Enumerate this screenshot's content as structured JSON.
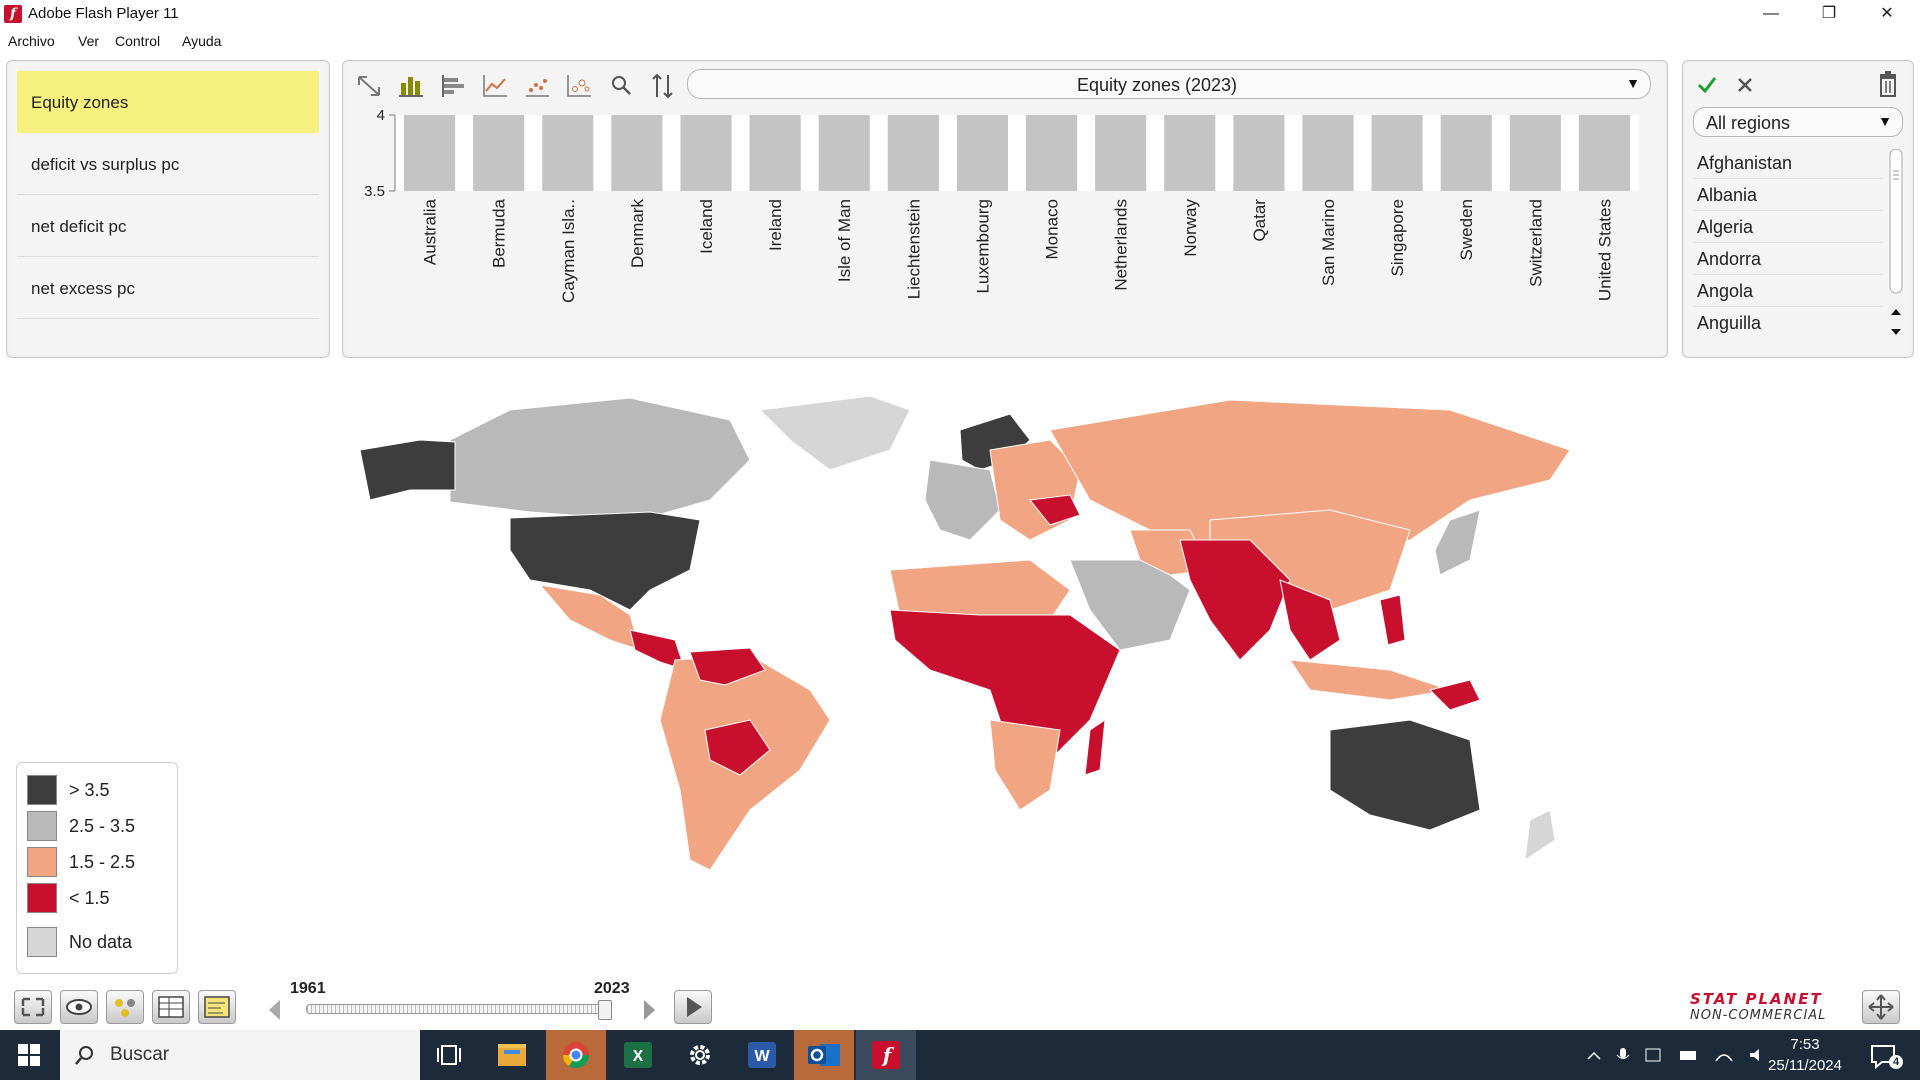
{
  "window": {
    "title": "Adobe Flash Player 11"
  },
  "menu": [
    "Archivo",
    "Ver",
    "Control",
    "Ayuda"
  ],
  "indicators": [
    {
      "label": "Equity zones",
      "selected": true
    },
    {
      "label": "deficit vs surplus pc",
      "selected": false
    },
    {
      "label": "net deficit pc",
      "selected": false
    },
    {
      "label": "net excess pc",
      "selected": false
    }
  ],
  "chart_toolbar": {
    "icons": [
      "fit-icon",
      "bar-chart-icon",
      "horizontal-bar-icon",
      "line-chart-icon",
      "scatter-icon",
      "bubble-icon",
      "zoom-icon",
      "sort-icon"
    ],
    "selected_indicator": "Equity zones (2023)"
  },
  "chart_data": {
    "type": "bar",
    "title": "",
    "categories": [
      "Australia",
      "Bermuda",
      "Cayman Isla..",
      "Denmark",
      "Iceland",
      "Ireland",
      "Isle of Man",
      "Liechtenstein",
      "Luxembourg",
      "Monaco",
      "Netherlands",
      "Norway",
      "Qatar",
      "San Marino",
      "Singapore",
      "Sweden",
      "Switzerland",
      "United States"
    ],
    "values": [
      4,
      4,
      4,
      4,
      4,
      4,
      4,
      4,
      4,
      4,
      4,
      4,
      4,
      4,
      4,
      4,
      4,
      4
    ],
    "ylim": [
      3.5,
      4
    ],
    "yticks": [
      "4",
      "3.5"
    ],
    "bar_color": "#c4c4c4",
    "xlabel": "",
    "ylabel": ""
  },
  "regions": {
    "selected": "All regions",
    "countries": [
      "Afghanistan",
      "Albania",
      "Algeria",
      "Andorra",
      "Angola",
      "Anguilla"
    ]
  },
  "legend": [
    {
      "label": "> 3.5",
      "color": "#3d3d3d"
    },
    {
      "label": "2.5 - 3.5",
      "color": "#b9b9b9"
    },
    {
      "label": "1.5 - 2.5",
      "color": "#f2a582"
    },
    {
      "label": "< 1.5",
      "color": "#c8102e"
    },
    {
      "label": "No data",
      "color": "#d6d6d6"
    }
  ],
  "timeline": {
    "start": "1961",
    "end": "2023",
    "position": 1.0
  },
  "brand": {
    "line1": "STAT PLANET",
    "line2": "NON-COMMERCIAL"
  },
  "taskbar": {
    "search_placeholder": "Buscar",
    "time": "7:53",
    "date": "25/11/2024",
    "notifications": "4"
  }
}
